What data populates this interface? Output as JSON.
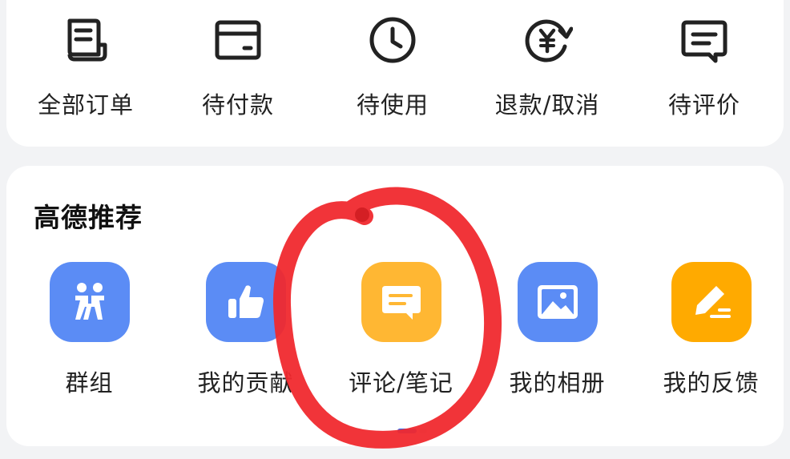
{
  "orders": {
    "items": [
      {
        "label": "全部订单",
        "icon": "order-list-icon"
      },
      {
        "label": "待付款",
        "icon": "card-icon"
      },
      {
        "label": "待使用",
        "icon": "clock-icon"
      },
      {
        "label": "退款/取消",
        "icon": "refund-yen-icon"
      },
      {
        "label": "待评价",
        "icon": "comment-icon"
      }
    ]
  },
  "recommend": {
    "title": "高德推荐",
    "items": [
      {
        "label": "群组",
        "icon": "group-icon",
        "color": "#5b8cf5"
      },
      {
        "label": "我的贡献",
        "icon": "thumbs-up-icon",
        "color": "#5b8cf5"
      },
      {
        "label": "评论/笔记",
        "icon": "comment-icon",
        "color": "#ffb733"
      },
      {
        "label": "我的相册",
        "icon": "album-icon",
        "color": "#5b8cf5"
      },
      {
        "label": "我的反馈",
        "icon": "edit-icon",
        "color": "#ffaa00"
      }
    ]
  },
  "pager": {
    "active_index": 0,
    "count": 2
  },
  "annotation": {
    "color": "#f0292e",
    "shape": "hand-drawn-circle"
  }
}
